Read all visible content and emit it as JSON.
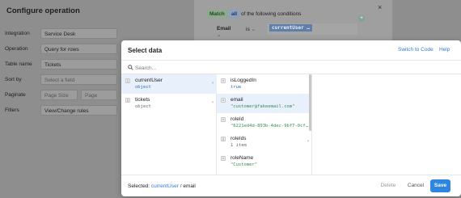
{
  "background": {
    "title": "Configure operation",
    "rows": [
      {
        "label": "Integration",
        "value": "Service Desk"
      },
      {
        "label": "Operation",
        "value": "Query for rows"
      },
      {
        "label": "Table name",
        "value": "Tickets"
      },
      {
        "label": "Sort by",
        "value": "Select a field"
      },
      {
        "label": "Paginate",
        "value": "Page Size",
        "value2": "Page"
      },
      {
        "label": "Filters",
        "value": "View/Change rules"
      }
    ]
  },
  "conditions": {
    "match": "Match",
    "all": "all",
    "rest": "of the following conditions",
    "close": "×",
    "field": "Email",
    "operator": "is",
    "value": "currentUser …"
  },
  "modal": {
    "title": "Select data",
    "switch_label": "Switch to Code",
    "help_label": "Help",
    "search_placeholder": "Search...",
    "col1": [
      {
        "name": "currentUser",
        "type": "object",
        "selected": true
      },
      {
        "name": "tickets",
        "type": "object",
        "selected": false
      }
    ],
    "col2": [
      {
        "name": "isLoggedIn",
        "value": "true"
      },
      {
        "name": "email",
        "value": "\"customer@fakeemail.com\""
      },
      {
        "name": "roleId",
        "value": "\"6221ed4d-893b-4dec-9bf7-0cf…"
      },
      {
        "name": "roleIds",
        "value": "1 item"
      },
      {
        "name": "roleName",
        "value": "\"Customer\""
      }
    ],
    "footer": {
      "selected_label": "Selected:",
      "path_a": "currentUser",
      "sep": "/",
      "path_b": "email",
      "delete": "Delete",
      "cancel": "Cancel",
      "save": "Save"
    }
  },
  "colors": {
    "accent": "#2f86e0",
    "selected_bg": "#e8f0fb"
  }
}
